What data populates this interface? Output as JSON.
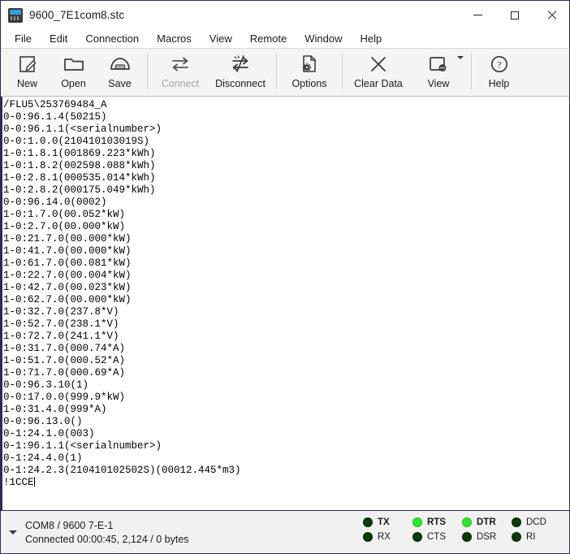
{
  "window": {
    "title": "9600_7E1com8.stc",
    "icon": "terminal-device-icon",
    "controls": {
      "minimize": "minimize-icon",
      "maximize": "maximize-icon",
      "close": "close-icon"
    }
  },
  "menubar": {
    "items": [
      {
        "label": "File"
      },
      {
        "label": "Edit"
      },
      {
        "label": "Connection"
      },
      {
        "label": "Macros"
      },
      {
        "label": "View"
      },
      {
        "label": "Remote"
      },
      {
        "label": "Window"
      },
      {
        "label": "Help"
      }
    ]
  },
  "toolbar": {
    "buttons": [
      {
        "label": "New",
        "icon": "new-document-icon",
        "disabled": false,
        "dropdown": false
      },
      {
        "label": "Open",
        "icon": "folder-open-icon",
        "disabled": false,
        "dropdown": false
      },
      {
        "label": "Save",
        "icon": "save-disk-icon",
        "disabled": false,
        "dropdown": false
      },
      {
        "label": "Connect",
        "icon": "connect-arrows-icon",
        "disabled": true,
        "dropdown": false
      },
      {
        "label": "Disconnect",
        "icon": "disconnect-arrows-icon",
        "disabled": false,
        "dropdown": false
      },
      {
        "label": "Options",
        "icon": "options-gear-document-icon",
        "disabled": false,
        "dropdown": false
      },
      {
        "label": "Clear Data",
        "icon": "clear-x-icon",
        "disabled": false,
        "dropdown": false
      },
      {
        "label": "View",
        "icon": "view-window-icon",
        "disabled": false,
        "dropdown": true
      },
      {
        "label": "Help",
        "icon": "help-question-icon",
        "disabled": false,
        "dropdown": false
      }
    ]
  },
  "terminal": {
    "lines": [
      "/FLU5\\253769484_A",
      "0-0:96.1.4(50215)",
      "0-0:96.1.1(<serialnumber>)",
      "0-0:1.0.0(210410103019S)",
      "1-0:1.8.1(001869.223*kWh)",
      "1-0:1.8.2(002598.088*kWh)",
      "1-0:2.8.1(000535.014*kWh)",
      "1-0:2.8.2(000175.049*kWh)",
      "0-0:96.14.0(0002)",
      "1-0:1.7.0(00.052*kW)",
      "1-0:2.7.0(00.000*kW)",
      "1-0:21.7.0(00.000*kW)",
      "1-0:41.7.0(00.000*kW)",
      "1-0:61.7.0(00.081*kW)",
      "1-0:22.7.0(00.004*kW)",
      "1-0:42.7.0(00.023*kW)",
      "1-0:62.7.0(00.000*kW)",
      "1-0:32.7.0(237.8*V)",
      "1-0:52.7.0(238.1*V)",
      "1-0:72.7.0(241.1*V)",
      "1-0:31.7.0(000.74*A)",
      "1-0:51.7.0(000.52*A)",
      "1-0:71.7.0(000.69*A)",
      "0-0:96.3.10(1)",
      "0-0:17.0.0(999.9*kW)",
      "1-0:31.4.0(999*A)",
      "0-0:96.13.0()",
      "0-1:24.1.0(003)",
      "0-1:96.1.1(<serialnumber>)",
      "0-1:24.4.0(1)",
      "0-1:24.2.3(210410102502S)(00012.445*m3)"
    ],
    "last_line": "!1CCE"
  },
  "statusbar": {
    "connection": "COM8 / 9600 7-E-1",
    "status": "Connected 00:00:45, 2,124 / 0 bytes",
    "expander_icon": "chevron-down-icon",
    "leds": [
      {
        "label": "TX",
        "on": false,
        "active": true
      },
      {
        "label": "RX",
        "on": false,
        "active": false
      },
      {
        "label": "RTS",
        "on": true,
        "active": true
      },
      {
        "label": "CTS",
        "on": false,
        "active": false
      },
      {
        "label": "DTR",
        "on": true,
        "active": true
      },
      {
        "label": "DSR",
        "on": false,
        "active": false
      },
      {
        "label": "DCD",
        "on": false,
        "active": false
      },
      {
        "label": "RI",
        "on": false,
        "active": false
      }
    ]
  },
  "colors": {
    "led_on": "#2ee62e",
    "led_off": "#0b3a0b",
    "border": "#2b2b5c",
    "toolbar_bg": "#f4f4f4",
    "statusbar_bg": "#f1f1f1"
  }
}
